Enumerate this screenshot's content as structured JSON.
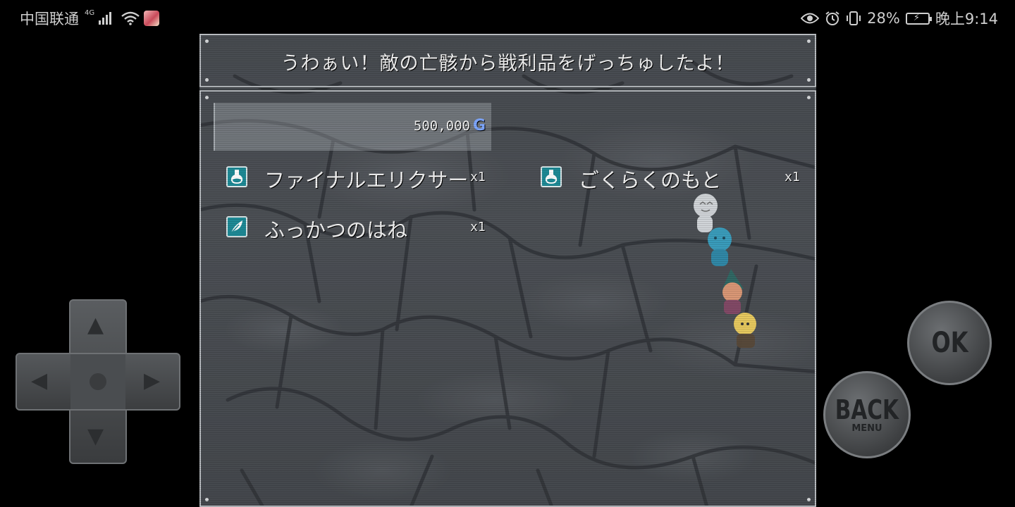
{
  "status_bar": {
    "carrier": "中国联通",
    "network_type": "4G",
    "battery_percent": "28%",
    "time": "晚上9:14"
  },
  "battle_result": {
    "message": "うわぁい！敵の亡骸から戦利品をげっちゅしたよ！",
    "gold_amount": "500,000",
    "gold_unit": "G",
    "items": [
      {
        "name": "ファイナルエリクサー",
        "quantity": "x1",
        "icon": "potion-icon"
      },
      {
        "name": "ごくらくのもと",
        "quantity": "x1",
        "icon": "potion-icon"
      },
      {
        "name": "ふっかつのはね",
        "quantity": "x1",
        "icon": "feather-icon"
      }
    ]
  },
  "controls": {
    "ok_label": "OK",
    "back_label": "BACK",
    "back_sub_label": "MENU"
  },
  "colors": {
    "window_border": "#b8bcc0",
    "item_icon_bg": "#1e8a96",
    "gold_unit": "#7fa8ff",
    "text": "#f2f2f2"
  }
}
